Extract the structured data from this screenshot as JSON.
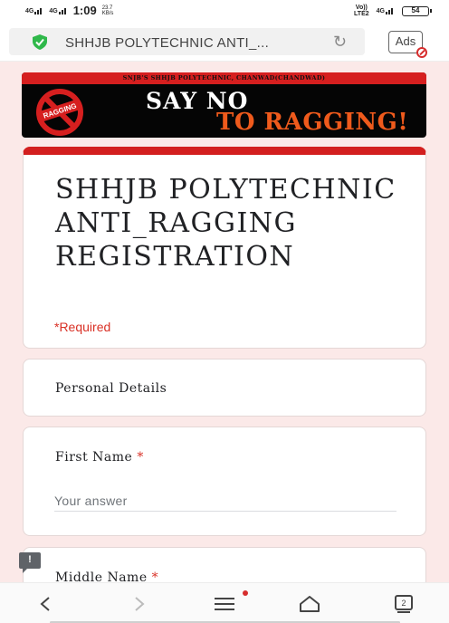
{
  "status_bar": {
    "network_left_1": "4G",
    "network_left_2": "4G",
    "time": "1:09",
    "speed_value": "23.7",
    "speed_unit": "KB/s",
    "volte_label": "Vo))",
    "lte_label": "LTE2",
    "network_right": "4G",
    "battery": "54"
  },
  "address_bar": {
    "url_text": "SHHJB POLYTECHNIC ANTI_...",
    "ads_label": "Ads"
  },
  "banner": {
    "top_text": "SNJB'S SHHJB POLYTECHNIC, CHANWAD(CHANDWAD)",
    "sign_text": "RAGGING",
    "line1": "SAY NO",
    "line2": "TO RAGGING!"
  },
  "form": {
    "title": "SHHJB POLYTECHNIC ANTI_RAGGING REGISTRATION",
    "required_note": "*Required",
    "section_title": "Personal Details",
    "questions": [
      {
        "label": "First Name",
        "required_mark": "*",
        "placeholder": "Your answer"
      },
      {
        "label": "Middle Name",
        "required_mark": "*"
      }
    ]
  },
  "bottom_nav": {
    "tabs_count": "2"
  },
  "colors": {
    "accent_red": "#d31f1f",
    "page_bg": "#fbe9e8",
    "required_red": "#d93025",
    "banner_orange": "#ef5a1c"
  }
}
